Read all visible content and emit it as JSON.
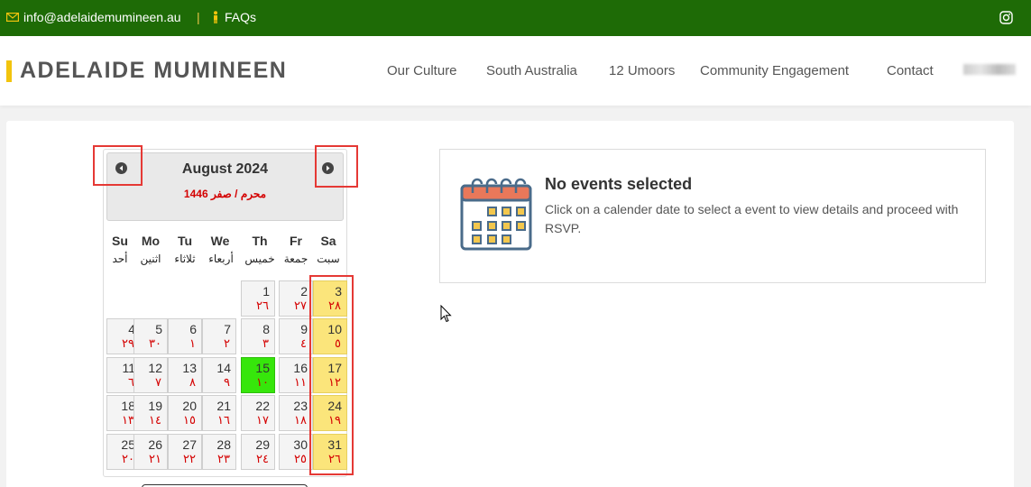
{
  "topbar": {
    "email": "info@adelaidemumineen.au",
    "separator": "|",
    "faq": "FAQs",
    "icons": {
      "email": "envelope-icon",
      "faq": "person-icon",
      "social": "instagram-icon"
    }
  },
  "header": {
    "brand": "ADELAIDE MUMINEEN",
    "nav": [
      "Our Culture",
      "South Australia",
      "12 Umoors",
      "Community Engagement",
      "Contact"
    ]
  },
  "calendar": {
    "month": "August 2024",
    "hijri": "محرم / صفر 1446",
    "weekdays": [
      {
        "en": "Su",
        "ar": "أحد"
      },
      {
        "en": "Mo",
        "ar": "اثنين"
      },
      {
        "en": "Tu",
        "ar": "ثلاثاء"
      },
      {
        "en": "We",
        "ar": "أربعاء"
      },
      {
        "en": "Th",
        "ar": "خميس"
      },
      {
        "en": "Fr",
        "ar": "جمعة"
      },
      {
        "en": "Sa",
        "ar": "سبت"
      }
    ],
    "days": [
      {
        "g": "1",
        "h": "٢٦"
      },
      {
        "g": "2",
        "h": "٢٧"
      },
      {
        "g": "3",
        "h": "٢٨"
      },
      {
        "g": "4",
        "h": "٢٩"
      },
      {
        "g": "5",
        "h": "٣٠"
      },
      {
        "g": "6",
        "h": "١"
      },
      {
        "g": "7",
        "h": "٢"
      },
      {
        "g": "8",
        "h": "٣"
      },
      {
        "g": "9",
        "h": "٤"
      },
      {
        "g": "10",
        "h": "٥"
      },
      {
        "g": "11",
        "h": "٦"
      },
      {
        "g": "12",
        "h": "٧"
      },
      {
        "g": "13",
        "h": "٨"
      },
      {
        "g": "14",
        "h": "٩"
      },
      {
        "g": "15",
        "h": "١٠"
      },
      {
        "g": "16",
        "h": "١١"
      },
      {
        "g": "17",
        "h": "١٢"
      },
      {
        "g": "18",
        "h": "١٣"
      },
      {
        "g": "19",
        "h": "١٤"
      },
      {
        "g": "20",
        "h": "١٥"
      },
      {
        "g": "21",
        "h": "١٦"
      },
      {
        "g": "22",
        "h": "١٧"
      },
      {
        "g": "23",
        "h": "١٨"
      },
      {
        "g": "24",
        "h": "١٩"
      },
      {
        "g": "25",
        "h": "٢٠"
      },
      {
        "g": "26",
        "h": "٢١"
      },
      {
        "g": "27",
        "h": "٢٢"
      },
      {
        "g": "28",
        "h": "٢٣"
      },
      {
        "g": "29",
        "h": "٢٤"
      },
      {
        "g": "30",
        "h": "٢٥"
      },
      {
        "g": "31",
        "h": "٢٦"
      }
    ],
    "today": "15",
    "colors": {
      "saturday": "#fbe57b",
      "today": "#36e60b",
      "hijri_text": "#d40000"
    }
  },
  "events": {
    "title": "No events selected",
    "description": "Click on a calender date to select a event to view details and proceed with RSVP."
  },
  "colors": {
    "topbar": "#1e6b06",
    "accent": "#f2c40d",
    "annotation": "#e53935"
  }
}
